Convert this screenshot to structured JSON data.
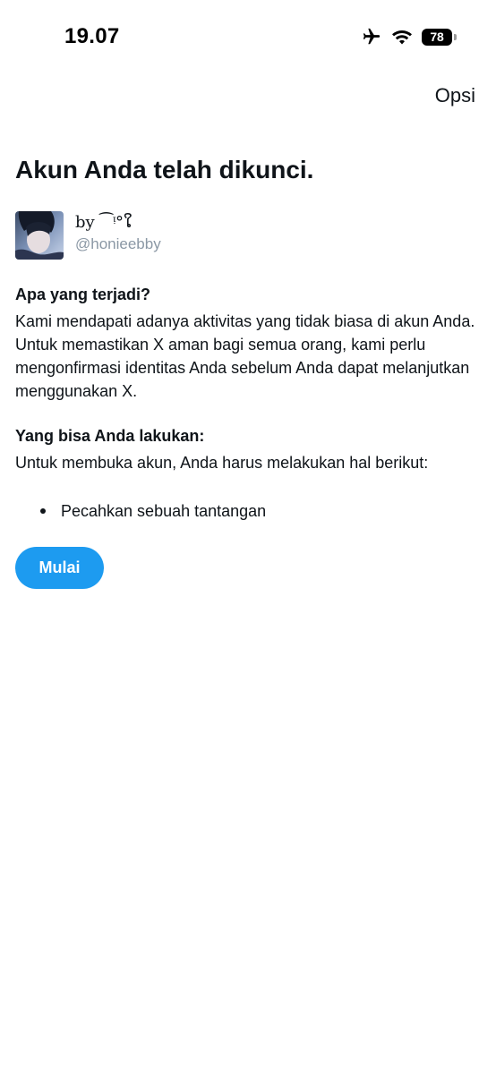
{
  "status_bar": {
    "time": "19.07",
    "battery_level": "78",
    "icons": [
      "airplane-icon",
      "wifi-icon",
      "battery-icon"
    ]
  },
  "header": {
    "options_label": "Opsi"
  },
  "page": {
    "title": "Akun Anda telah dikunci."
  },
  "account": {
    "display_name": "by ⁀ᵎ°ໃ",
    "handle": "@honieebby"
  },
  "what_happened": {
    "heading": "Apa yang terjadi?",
    "body": "Kami mendapati adanya aktivitas yang tidak biasa di akun Anda. Untuk memastikan X aman bagi semua orang, kami perlu mengonfirmasi identitas Anda sebelum Anda dapat melanjutkan menggunakan X."
  },
  "what_you_can_do": {
    "heading": "Yang bisa Anda lakukan:",
    "body": "Untuk membuka akun, Anda harus melakukan hal berikut:",
    "items": [
      "Pecahkan sebuah tantangan"
    ]
  },
  "actions": {
    "start_label": "Mulai"
  },
  "colors": {
    "accent": "#1d9bf0",
    "text": "#0f1419",
    "secondary_text": "#8b98a5",
    "background": "#ffffff"
  }
}
